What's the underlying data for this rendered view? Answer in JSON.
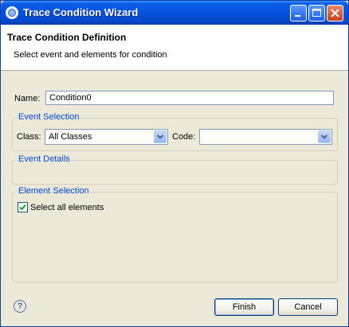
{
  "window": {
    "title": "Trace Condition Wizard"
  },
  "banner": {
    "title": "Trace Condition Definition",
    "description": "Select event and elements for condition"
  },
  "form": {
    "name_label": "Name:",
    "name_value": "Condition0"
  },
  "event_selection": {
    "title": "Event Selection",
    "class_label": "Class:",
    "class_value": "All Classes",
    "code_label": "Code:",
    "code_value": ""
  },
  "event_details": {
    "title": "Event Details"
  },
  "element_selection": {
    "title": "Element Selection",
    "select_all_label": "Select all elements",
    "select_all_checked": true
  },
  "footer": {
    "help_glyph": "?",
    "finish_label": "Finish",
    "cancel_label": "Cancel"
  },
  "colors": {
    "titlebar": "#0553dd",
    "group_title": "#0046d5",
    "dialog_bg": "#ece9d8"
  },
  "icons": [
    "app-icon",
    "minimize-icon",
    "maximize-icon",
    "close-icon",
    "dropdown-arrow-icon",
    "checkmark-icon",
    "help-icon"
  ]
}
